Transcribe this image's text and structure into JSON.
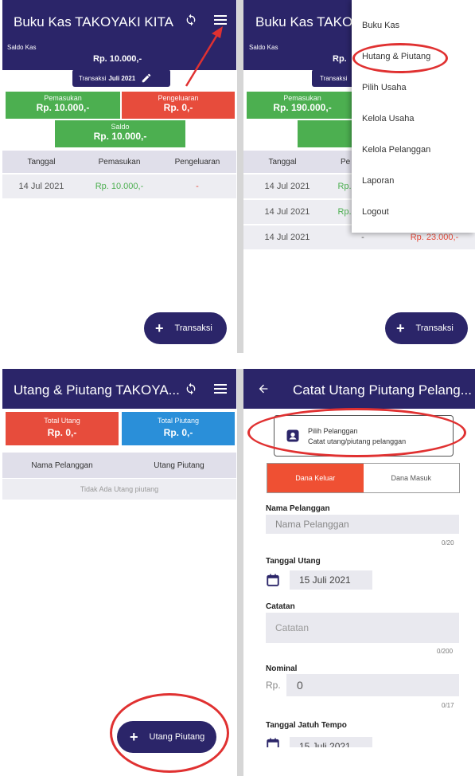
{
  "colors": {
    "appbar": "#2b2569",
    "income": "#4caf50",
    "expense": "#e74c3c",
    "receivable": "#2a8fd9",
    "highlight": "#e03131",
    "table_header": "#e0dfea",
    "row_bg": "#ededf2"
  },
  "screen1": {
    "title": "Buku Kas TAKOYAKI KITA",
    "saldo_kas_label": "Saldo Kas",
    "saldo_kas_value": "Rp. 10.000,-",
    "transaksi_prefix": "Transaksi",
    "transaksi_month": "Juli 2021",
    "pemasukan_label": "Pemasukan",
    "pemasukan_value": "Rp. 10.000,-",
    "pengeluaran_label": "Pengeluaran",
    "pengeluaran_value": "Rp. 0,-",
    "saldo_label": "Saldo",
    "saldo_value": "Rp. 10.000,-",
    "columns": [
      "Tanggal",
      "Pemasukan",
      "Pengeluaran"
    ],
    "rows": [
      {
        "tanggal": "14 Jul 2021",
        "pemasukan": "Rp. 10.000,-",
        "pengeluaran": "-"
      }
    ],
    "fab_label": "Transaksi",
    "icons": [
      "sync-icon",
      "menu-icon",
      "pencil-icon"
    ]
  },
  "screen2": {
    "title_partial": "Buku Kas TAKOY",
    "saldo_kas_label": "Saldo Kas",
    "saldo_kas_partial": "Rp.",
    "transaksi_partial": "Transaksi",
    "pemasukan_label": "Pemasukan",
    "pemasukan_value": "Rp. 190.000,-",
    "saldo_partial": "Rp. T",
    "columns_partial": [
      "Tanggal",
      "Pe"
    ],
    "rows": [
      {
        "tanggal": "14 Jul 2021",
        "partial": "Rp."
      },
      {
        "tanggal": "14 Jul 2021",
        "partial": "Rp."
      },
      {
        "tanggal": "14 Jul 2021",
        "partial": "-",
        "pengeluaran": "Rp. 23.000,-"
      }
    ],
    "menu_items": [
      "Buku Kas",
      "Hutang & Piutang",
      "Pilih Usaha",
      "Kelola Usaha",
      "Kelola Pelanggan",
      "Laporan",
      "Logout"
    ],
    "fab_label": "Transaksi"
  },
  "screen3": {
    "title": "Utang & Piutang TAKOYA...",
    "total_utang_label": "Total Utang",
    "total_utang_value": "Rp. 0,-",
    "total_piutang_label": "Total Piutang",
    "total_piutang_value": "Rp. 0,-",
    "columns": [
      "Nama Pelanggan",
      "Utang Piutang"
    ],
    "empty_text": "Tidak Ada Utang piutang",
    "fab_label": "Utang Piutang"
  },
  "screen4": {
    "title": "Catat Utang Piutang Pelang...",
    "pilih_title": "Pilih Pelanggan",
    "pilih_subtitle": "Catat utang/piutang pelanggan",
    "tab_keluar": "Dana Keluar",
    "tab_masuk": "Dana Masuk",
    "nama_label": "Nama Pelanggan",
    "nama_placeholder": "Nama Pelanggan",
    "nama_counter": "0/20",
    "tanggal_label": "Tanggal Utang",
    "tanggal_value": "15 Juli 2021",
    "catatan_label": "Catatan",
    "catatan_placeholder": "Catatan",
    "catatan_counter": "0/200",
    "nominal_label": "Nominal",
    "nominal_prefix": "Rp.",
    "nominal_value": "0",
    "nominal_counter": "0/17",
    "jatuh_tempo_label": "Tanggal Jatuh Tempo",
    "jatuh_tempo_value": "15 Juli 2021"
  }
}
